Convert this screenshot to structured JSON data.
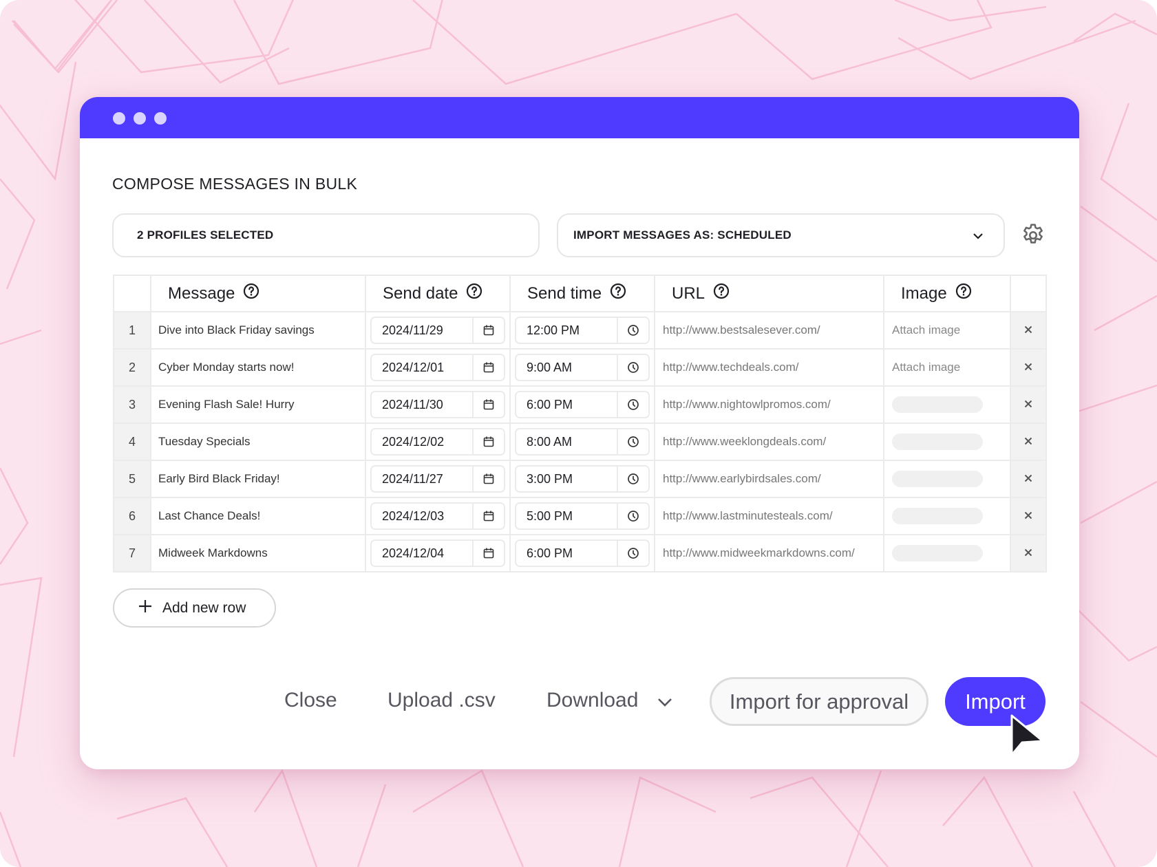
{
  "window": {
    "title": "COMPOSE MESSAGES IN BULK",
    "titlebar_color": "#4f3aff",
    "window_controls": [
      "dot",
      "dot",
      "dot"
    ]
  },
  "toolbar": {
    "profiles_selected": "2 PROFILES SELECTED",
    "import_as_label": "IMPORT MESSAGES AS: SCHEDULED",
    "import_as_icon": "chevron-down-icon",
    "settings_icon": "gear-icon"
  },
  "table": {
    "columns": [
      {
        "label": "Message",
        "help_icon": "question-circle-icon"
      },
      {
        "label": "Send date",
        "help_icon": "question-circle-icon"
      },
      {
        "label": "Send time",
        "help_icon": "question-circle-icon"
      },
      {
        "label": "URL",
        "help_icon": "question-circle-icon"
      },
      {
        "label": "Image",
        "help_icon": "question-circle-icon"
      }
    ],
    "rows": [
      {
        "num": "1",
        "message": "Dive into Black Friday savings",
        "date": "2024/11/29",
        "time": "12:00 PM",
        "url": "http://www.bestsalesever.com/",
        "image": "Attach image"
      },
      {
        "num": "2",
        "message": "Cyber Monday starts now!",
        "date": "2024/12/01",
        "time": "9:00 AM",
        "url": "http://www.techdeals.com/",
        "image": "Attach image"
      },
      {
        "num": "3",
        "message": "Evening Flash Sale! Hurry",
        "date": "2024/11/30",
        "time": "6:00 PM",
        "url": "http://www.nightowlpromos.com/",
        "image": ""
      },
      {
        "num": "4",
        "message": "Tuesday Specials",
        "date": "2024/12/02",
        "time": "8:00 AM",
        "url": "http://www.weeklongdeals.com/",
        "image": ""
      },
      {
        "num": "5",
        "message": "Early Bird Black Friday!",
        "date": "2024/11/27",
        "time": "3:00 PM",
        "url": "http://www.earlybirdsales.com/",
        "image": ""
      },
      {
        "num": "6",
        "message": "Last Chance Deals!",
        "date": "2024/12/03",
        "time": "5:00 PM",
        "url": "http://www.lastminutesteals.com/",
        "image": ""
      },
      {
        "num": "7",
        "message": "Midweek Markdowns",
        "date": "2024/12/04",
        "time": "6:00 PM",
        "url": "http://www.midweekmarkdowns.com/",
        "image": ""
      }
    ],
    "delete_glyph": "✕"
  },
  "add_row": {
    "label": "Add new row",
    "icon": "plus-icon"
  },
  "footer": {
    "close": "Close",
    "upload": "Upload .csv",
    "download": "Download",
    "import_for_approval": "Import for approval",
    "import": "Import"
  },
  "colors": {
    "accent": "#4f3aff",
    "background": "#fce4ee"
  }
}
